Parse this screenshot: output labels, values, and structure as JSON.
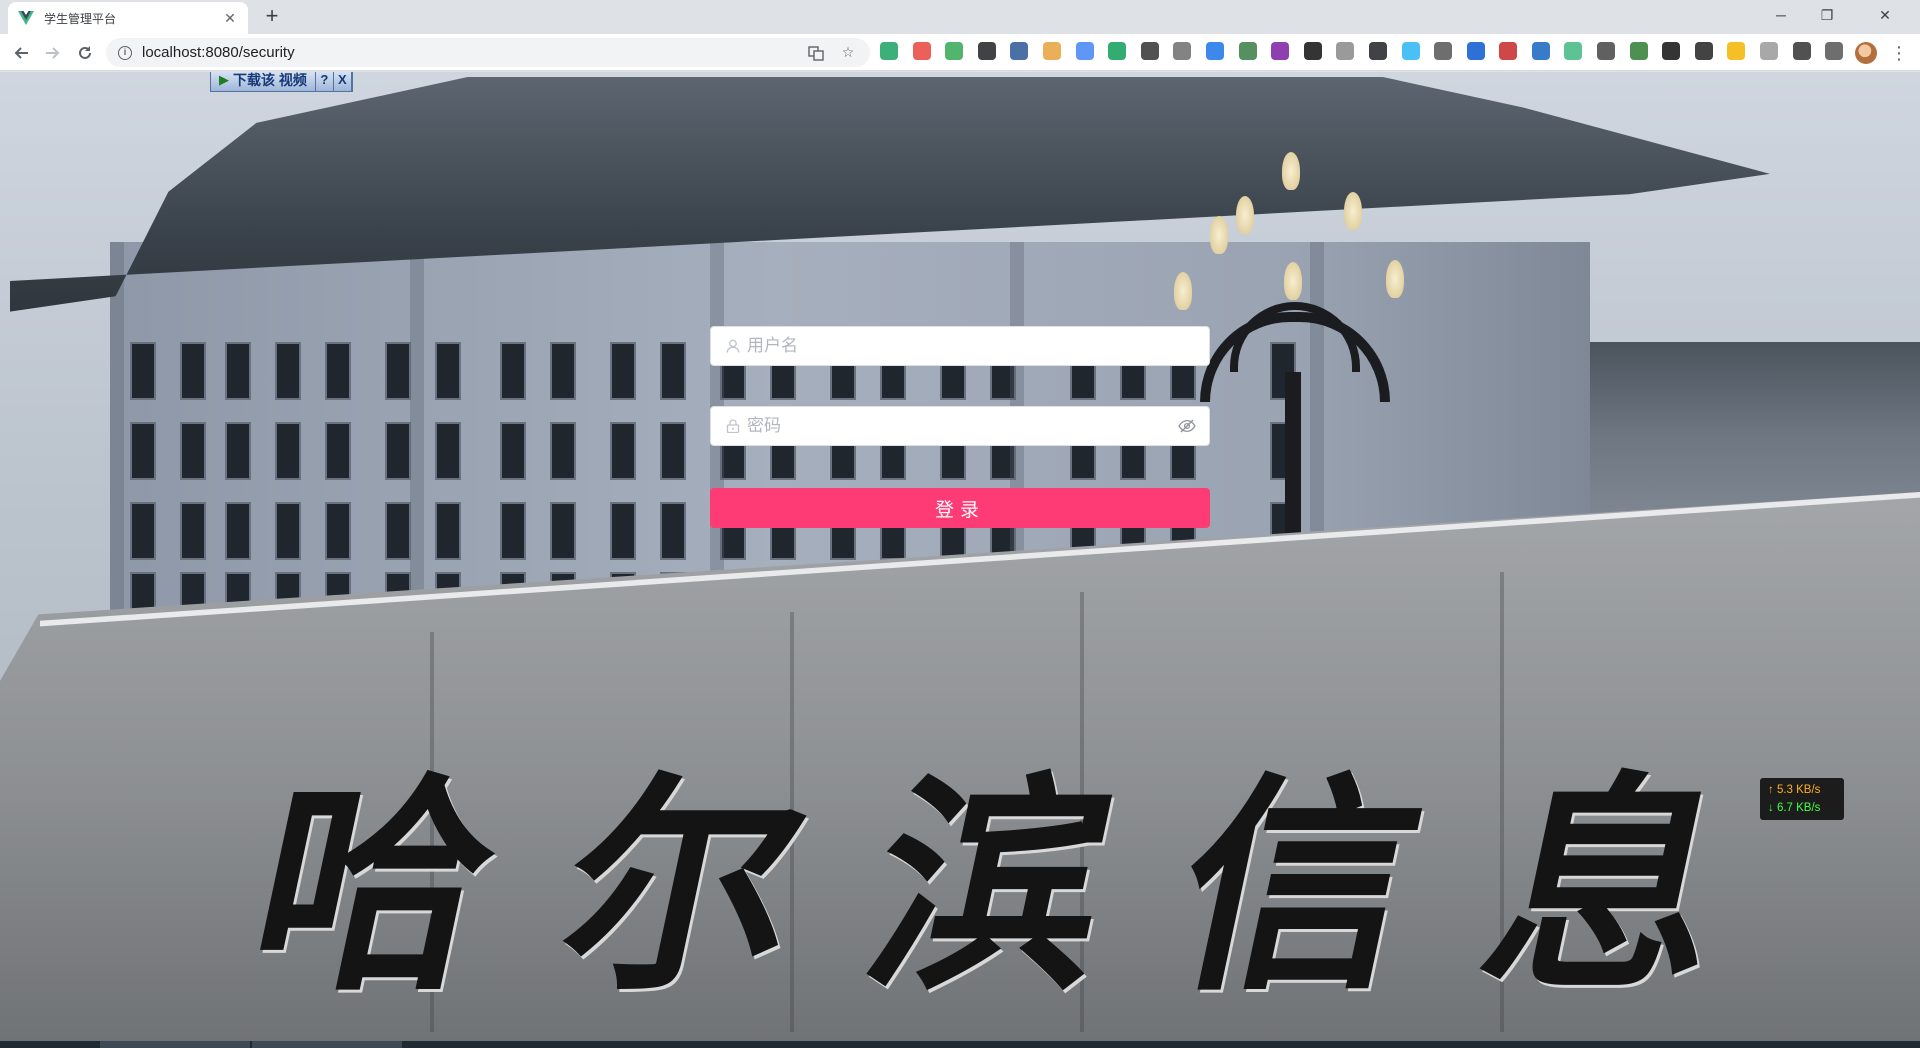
{
  "browser": {
    "tab_title": "学生管理平台",
    "url": "localhost:8080/security",
    "new_tab": "+",
    "window": {
      "minimize": "─",
      "maximize": "❐",
      "close": "✕"
    },
    "extension_count": 30
  },
  "video_widget": {
    "download_label": "下载该 视频",
    "help": "?",
    "close": "X"
  },
  "background": {
    "calligraphy_chars": [
      "哈",
      "尔",
      "滨",
      "信",
      "息"
    ]
  },
  "login": {
    "username_placeholder": "用户名",
    "password_placeholder": "密码",
    "submit_label": "登录"
  },
  "netspeed": {
    "up": "↑ 5.3 KB/s",
    "down": "↓ 6.7 KB/s"
  },
  "colors": {
    "accent": "#ff3b76",
    "chrome_bg": "#dee1e6",
    "netspeed_up": "#ffb020",
    "netspeed_down": "#44ff44"
  }
}
